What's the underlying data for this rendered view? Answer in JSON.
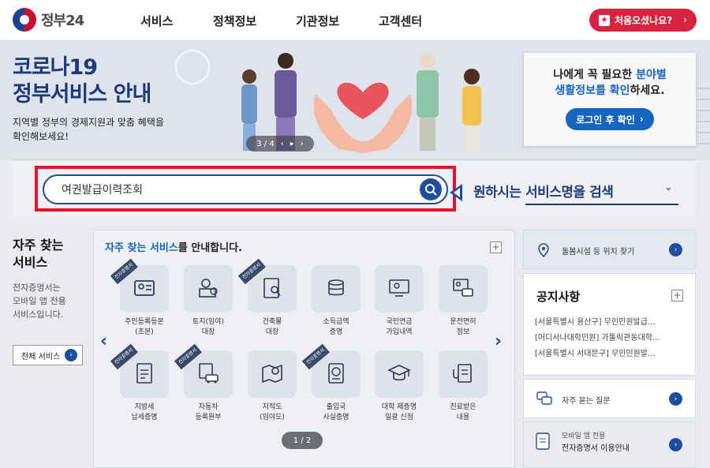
{
  "header": {
    "logo_text": "정부24",
    "nav": [
      "서비스",
      "정책정보",
      "기관정보",
      "고객센터"
    ],
    "first_visit_button": "처음오셨나요?"
  },
  "banner": {
    "title_line1": "코로나19",
    "title_line2": "정부서비스 안내",
    "subtitle_line1": "지역별 정부의 경제지원과 맞춤 혜택을",
    "subtitle_line2": "확인해보세요!",
    "pager": "3 / 4",
    "login_card": {
      "msg_pre": "나에게 꼭 필요한 ",
      "msg_hl1": "분야별",
      "msg_hl2": "생활정보를 확인",
      "msg_post": "하세요.",
      "button": "로그인 후 확인"
    }
  },
  "search": {
    "value": "여권발급이력조회",
    "callout": "원하시는 서비스명을 검색"
  },
  "left": {
    "title_line1": "자주 찾는",
    "title_line2": "서비스",
    "desc_line1": "전자증명서는",
    "desc_line2": "모바일 앱 전용",
    "desc_line3": "서비스입니다.",
    "all_button": "전체 서비스"
  },
  "services": {
    "head_blue": "자주 찾는 서비스",
    "head_rest": "를 안내합니다.",
    "ribbon_text": "전자증명서",
    "pager": "1 / 2",
    "items": [
      {
        "l1": "주민등록등본",
        "l2": "(초본)",
        "icon": "id-card-icon"
      },
      {
        "l1": "토지(임야)",
        "l2": "대장",
        "icon": "map-pin-icon"
      },
      {
        "l1": "건축물",
        "l2": "대장",
        "icon": "document-search-icon"
      },
      {
        "l1": "소득금액",
        "l2": "증명",
        "icon": "coins-icon"
      },
      {
        "l1": "국민연금",
        "l2": "가입내역",
        "icon": "monitor-person-icon"
      },
      {
        "l1": "운전면허",
        "l2": "정보",
        "icon": "license-car-icon"
      },
      {
        "l1": "지방세",
        "l2": "납세증명",
        "icon": "tax-document-icon"
      },
      {
        "l1": "자동차",
        "l2": "등록원부",
        "icon": "car-document-icon"
      },
      {
        "l1": "지적도",
        "l2": "(임야도)",
        "icon": "map-search-icon"
      },
      {
        "l1": "출입국",
        "l2": "사실증명",
        "icon": "passport-icon"
      },
      {
        "l1": "대학 제증명",
        "l2": "일괄 신청",
        "icon": "graduation-cap-icon"
      },
      {
        "l1": "진료받은",
        "l2": "내용",
        "icon": "medical-record-icon"
      }
    ]
  },
  "right": {
    "care_facility": "돌봄시설 등 위치 찾기",
    "notice_title": "공지사항",
    "notices": [
      "[서울특별시 용산구] 무인민원발급...",
      "[어디서나대학민원] 가톨릭관동대학...",
      "[서울특별시 서대문구] 무인민원발..."
    ],
    "faq": "자주 묻는 질문",
    "app_line1": "모바일 앱 전용",
    "app_line2": "전자증명서 이용안내"
  }
}
